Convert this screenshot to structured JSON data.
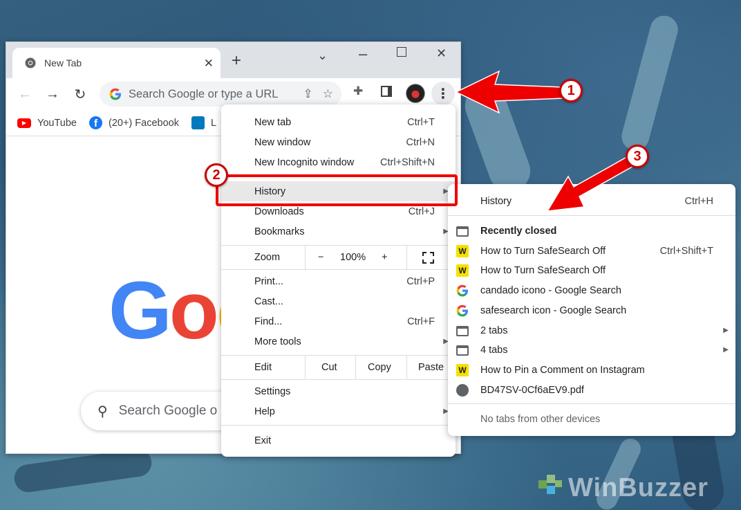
{
  "browser": {
    "tab_title": "New Tab",
    "omnibox_placeholder": "Search Google or type a URL",
    "bookmarks": [
      {
        "label": "YouTube",
        "icon": "youtube-icon"
      },
      {
        "label": "(20+) Facebook",
        "icon": "facebook-icon"
      },
      {
        "label": "L",
        "icon": "trello-icon"
      }
    ],
    "ntp_search_placeholder": "Search Google o"
  },
  "main_menu": {
    "items": {
      "new_tab": {
        "label": "New tab",
        "shortcut": "Ctrl+T"
      },
      "new_window": {
        "label": "New window",
        "shortcut": "Ctrl+N"
      },
      "new_incognito": {
        "label": "New Incognito window",
        "shortcut": "Ctrl+Shift+N"
      },
      "history": {
        "label": "History"
      },
      "downloads": {
        "label": "Downloads",
        "shortcut": "Ctrl+J"
      },
      "bookmarks": {
        "label": "Bookmarks"
      },
      "print": {
        "label": "Print...",
        "shortcut": "Ctrl+P"
      },
      "cast": {
        "label": "Cast..."
      },
      "find": {
        "label": "Find...",
        "shortcut": "Ctrl+F"
      },
      "more_tools": {
        "label": "More tools"
      },
      "settings": {
        "label": "Settings"
      },
      "help": {
        "label": "Help"
      },
      "exit": {
        "label": "Exit"
      }
    },
    "zoom": {
      "label": "Zoom",
      "minus": "−",
      "value": "100%",
      "plus": "+"
    },
    "edit": {
      "label": "Edit",
      "cut": "Cut",
      "copy": "Copy",
      "paste": "Paste"
    }
  },
  "history_menu": {
    "header": {
      "label": "History",
      "shortcut": "Ctrl+H"
    },
    "recently_closed": "Recently closed",
    "items": [
      {
        "label": "How to Turn SafeSearch Off",
        "shortcut": "Ctrl+Shift+T",
        "icon": "winbuzzer-icon"
      },
      {
        "label": "How to Turn SafeSearch Off",
        "shortcut": "",
        "icon": "winbuzzer-icon"
      },
      {
        "label": "candado icono - Google Search",
        "shortcut": "",
        "icon": "google-icon"
      },
      {
        "label": "safesearch icon - Google Search",
        "shortcut": "",
        "icon": "google-icon"
      },
      {
        "label": "2 tabs",
        "shortcut": "",
        "icon": "tab-group-icon"
      },
      {
        "label": "4 tabs",
        "shortcut": "",
        "icon": "tab-group-icon"
      },
      {
        "label": "How to Pin a Comment on Instagram",
        "shortcut": "",
        "icon": "winbuzzer-icon"
      },
      {
        "label": "BD47SV-0Cf6aEV9.pdf",
        "shortcut": "",
        "icon": "globe-icon"
      }
    ],
    "no_devices": "No tabs from other devices"
  },
  "annotations": {
    "step1": "1",
    "step2": "2",
    "step3": "3"
  },
  "watermark": "WinBuzzer",
  "colors": {
    "annotation_red": "#e00000",
    "menu_highlight": "#e8e8e8",
    "google_blue": "#4285f4",
    "google_red": "#ea4335",
    "google_yellow": "#fbbc05"
  }
}
